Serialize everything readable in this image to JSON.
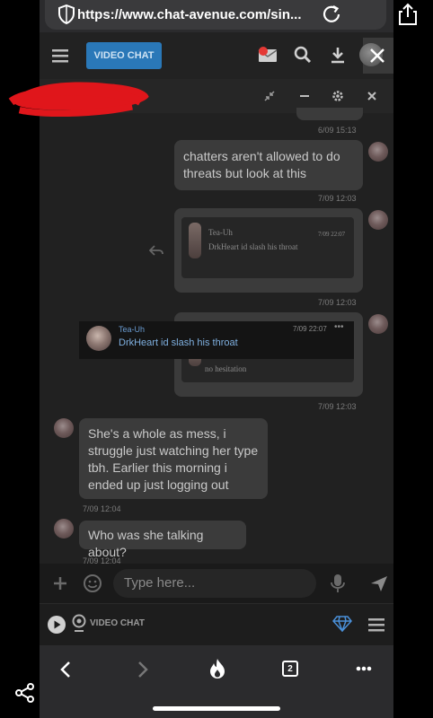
{
  "browser": {
    "url": "https://www.chat-avenue.com/sin...",
    "tab_count": "2"
  },
  "app": {
    "video_chat_button": "VIDEO CHAT",
    "input_placeholder": "Type here...",
    "footer_video_chat": "VIDEO CHAT"
  },
  "messages": [
    {
      "time": "6/09 15:13"
    },
    {
      "text": "chatters aren't allowed to do threats but look at this",
      "time": "7/09 12:03"
    },
    {
      "quote_name": "Tea-Uh",
      "quote_date": "7/09 22:07",
      "quote_text": "DrkHeart id slash his throat",
      "time": "7/09 12:03"
    },
    {
      "quote_text": "no hesitation",
      "time": "7/09 12:03"
    },
    {
      "text": "She's a whole as mess, i struggle just watching her type tbh. Earlier this morning i ended up just logging out",
      "time": "7/09 12:04"
    },
    {
      "text": "Who was she talking about?",
      "time": "7/09 12:04"
    }
  ],
  "overlay_quote": {
    "name": "Tea-Uh",
    "date": "7/09 22:07",
    "dots": "•••",
    "text": "DrkHeart id slash his throat"
  },
  "icons": {
    "colors": {
      "accent": "#2a78b8",
      "bubble": "#3b3b3b",
      "background": "#212121"
    }
  }
}
